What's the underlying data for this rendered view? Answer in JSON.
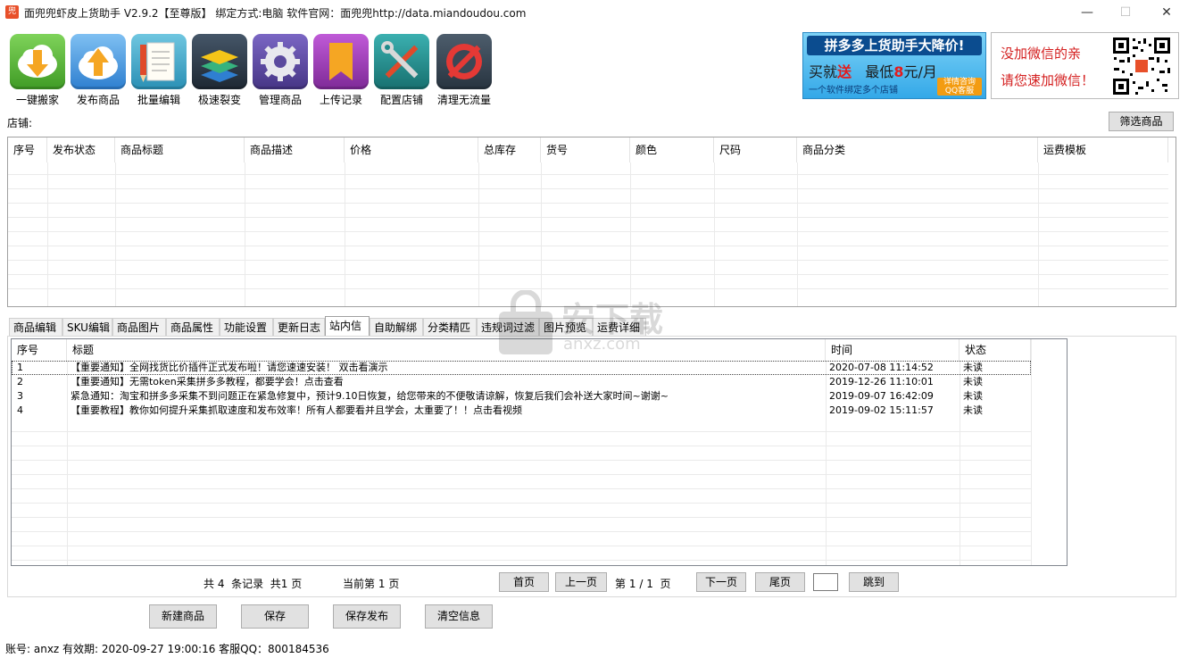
{
  "window": {
    "title": "面兜兜虾皮上货助手 V2.9.2【至尊版】 绑定方式:电脑    软件官网：面兜兜http://data.miandoudou.com",
    "app_icon_text": "兜",
    "minimize": "—",
    "maximize": "☐",
    "close": "✕"
  },
  "toolbar": [
    {
      "label": "一键搬家",
      "icon": "download-cloud-icon",
      "color": "#5dbb3a"
    },
    {
      "label": "发布商品",
      "icon": "upload-cloud-icon",
      "color": "#3d8fd8"
    },
    {
      "label": "批量编辑",
      "icon": "pencil-note-icon",
      "color": "#3aa6c9"
    },
    {
      "label": "极速裂变",
      "icon": "layers-icon",
      "color": "#2d3a4a"
    },
    {
      "label": "管理商品",
      "icon": "gear-icon",
      "color": "#5b4a9e"
    },
    {
      "label": "上传记录",
      "icon": "bookmark-icon",
      "color": "#9b3bb3"
    },
    {
      "label": "配置店铺",
      "icon": "tools-icon",
      "color": "#1f8a8a"
    },
    {
      "label": "清理无流量",
      "icon": "no-entry-icon",
      "color": "#3a4856"
    }
  ],
  "ad1": {
    "headline": "拼多多上货助手大降价!",
    "offer_a": "买就",
    "offer_b": "送",
    "offer_c": "最低",
    "offer_d": "8",
    "offer_e": "元/月",
    "tagline": "一个软件绑定多个店铺",
    "qq": "详情咨询 QQ客服"
  },
  "ad2": {
    "line1": "没加微信的亲",
    "line2": "请您速加微信！"
  },
  "store": {
    "label": "店铺:",
    "filter_button": "筛选商品"
  },
  "product_grid": {
    "columns": [
      "序号",
      "发布状态",
      "商品标题",
      "商品描述",
      "价格",
      "总库存",
      "货号",
      "颜色",
      "尺码",
      "商品分类",
      "运费模板"
    ]
  },
  "tabs": [
    "商品编辑",
    "SKU编辑",
    "商品图片",
    "商品属性",
    "功能设置",
    "更新日志",
    "站内信",
    "自助解绑",
    "分类精匹",
    "违规词过滤",
    "图片预览",
    "运费详细"
  ],
  "active_tab": "站内信",
  "messages": {
    "columns": [
      "序号",
      "标题",
      "时间",
      "状态"
    ],
    "rows": [
      {
        "no": "1",
        "title": "【重要通知】全网找货比价插件正式发布啦！请您速速安装！  双击看演示",
        "time": "2020-07-08 11:14:52",
        "status": "未读"
      },
      {
        "no": "2",
        "title": "【重要通知】无需token采集拼多多教程，都要学会！点击查看",
        "time": "2019-12-26 11:10:01",
        "status": "未读"
      },
      {
        "no": "3",
        "title": "紧急通知：淘宝和拼多多采集不到问题正在紧急修复中，预计9.10日恢复，给您带来的不便敬请谅解，恢复后我们会补送大家时间~谢谢~",
        "time": "2019-09-07 16:42:09",
        "status": "未读"
      },
      {
        "no": "4",
        "title": "【重要教程】教你如何提升采集抓取速度和发布效率！所有人都要看并且学会，太重要了！！点击看视频",
        "time": "2019-09-02 15:11:57",
        "status": "未读"
      }
    ]
  },
  "pager": {
    "total_a": "共",
    "total_n": "4",
    "total_b": "条记录",
    "pages_a": "共",
    "pages_n": "1",
    "pages_b": "页",
    "current_a": "当前第",
    "current_n": "1",
    "current_b": "页",
    "first": "首页",
    "prev": "上一页",
    "page_of_a": "第",
    "page_of_n": "1",
    "page_of_sep": "/",
    "page_of_total": "1",
    "page_of_b": "页",
    "next": "下一页",
    "last": "尾页",
    "jump_value": "",
    "jump": "跳到"
  },
  "actions": {
    "new": "新建商品",
    "save": "保存",
    "save_publish": "保存发布",
    "clear": "清空信息"
  },
  "status": {
    "text": "账号: anxz   有效期: 2020-09-27 19:00:16   客服QQ：800184536"
  },
  "watermark": {
    "text": "安下载",
    "url": "anxz.com"
  }
}
